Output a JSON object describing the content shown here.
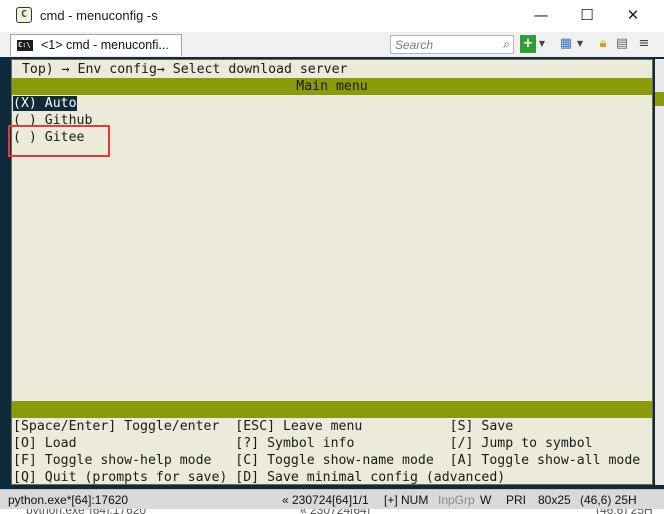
{
  "window": {
    "title": "cmd - menuconfig  -s",
    "app_icon": "conemu-icon",
    "controls": {
      "minimize": "—",
      "maximize": "☐",
      "close": "✕"
    }
  },
  "toolbar": {
    "tab_icon_text": "C:\\",
    "tab_label": "<1> cmd - menuconfi...",
    "search_placeholder": "Search",
    "icons": [
      "new-console-icon",
      "view-icon",
      "lock-icon",
      "settings-icon",
      "menu-icon"
    ]
  },
  "console": {
    "breadcrumb": " Top) → Env config→ Select download server",
    "header": "Main menu",
    "options": [
      {
        "mark": "(X)",
        "label": "Auto",
        "selected": true
      },
      {
        "mark": "( )",
        "label": "Github",
        "selected": false
      },
      {
        "mark": "( )",
        "label": "Gitee",
        "selected": false
      }
    ],
    "help": [
      "[Space/Enter] Toggle/enter  [ESC] Leave menu           [S] Save",
      "[O] Load                    [?] Symbol info            [/] Jump to symbol",
      "[F] Toggle show-help mode   [C] Toggle show-name mode  [A] Toggle show-all mode",
      "[Q] Quit (prompts for save) [D] Save minimal config (advanced)"
    ],
    "accent_color": "#8a9a0a",
    "annotation_color": "#e53935"
  },
  "statusbar": {
    "process": "python.exe*[64]:17620",
    "build": "« 230724[64]",
    "pages": "1/1",
    "mode": "[+] NUM",
    "inpgrp": "InpGrp",
    "w": "W",
    "pri": "PRI",
    "size": "80x25",
    "cursor": "(46,6) 25H"
  }
}
